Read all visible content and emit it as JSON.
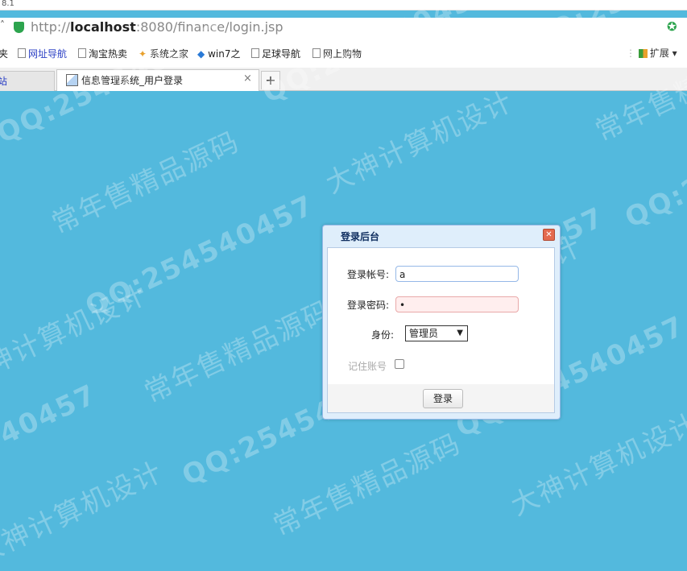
{
  "browser": {
    "version_fragment": "8.1",
    "url_prefix": "http://",
    "url_host": "localhost",
    "url_rest": ":8080/finance/login.jsp",
    "bookmarks": [
      "夹",
      "网址导航",
      "淘宝热卖",
      "系统之家",
      "win7之",
      "足球导航",
      "网上购物"
    ],
    "extensions_label": "扩展",
    "tab_fragment": "站",
    "active_tab_title": "信息管理系统_用户登录",
    "tab_close": "×",
    "new_tab": "+"
  },
  "watermarks": [
    "QQ:254540457",
    "常年售精品源码",
    "大神计算机设计"
  ],
  "dialog": {
    "title": "登录后台",
    "close_symbol": "✕",
    "account_label": "登录帐号:",
    "account_value": "a",
    "password_label": "登录密码:",
    "password_mask": "•",
    "role_label": "身份:",
    "role_selected": "管理员",
    "remember_label": "记住账号",
    "login_button": "登录"
  },
  "colors": {
    "page_background": "#53b9dd",
    "dialog_header": "#dfeefb",
    "dialog_border": "#95b8e7",
    "password_error_bg": "#ffeeee"
  }
}
